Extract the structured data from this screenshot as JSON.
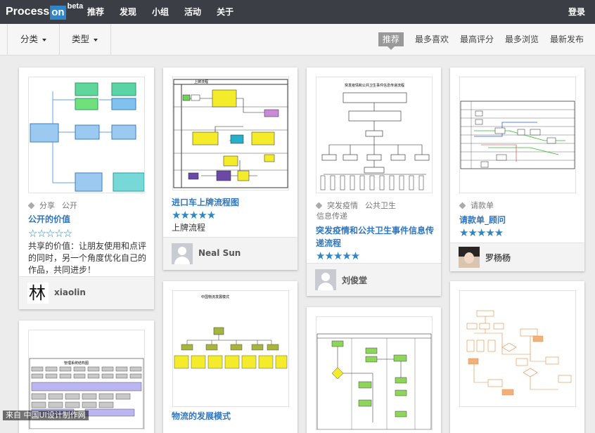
{
  "header": {
    "logo_text": "Process",
    "logo_on": "on",
    "logo_beta": "beta",
    "nav": [
      "推荐",
      "发现",
      "小组",
      "活动",
      "关于"
    ],
    "login": "登录"
  },
  "filters": {
    "category": "分类",
    "type": "类型",
    "sorts": [
      "推荐",
      "最多喜欢",
      "最高评分",
      "最多浏览",
      "最新发布"
    ],
    "active_sort": "推荐"
  },
  "cards": [
    {
      "tags": [
        "分享",
        "公开"
      ],
      "title": "公开的价值",
      "rating": 0,
      "desc": "共享的价值：让朋友使用和点评的同时，另一个角度优化自己的作品，共同进步！",
      "author": "xiaolin",
      "avatar_char": "林"
    },
    {
      "tags": [],
      "title": "进口车上牌流程图",
      "rating": 5,
      "desc": "上牌流程",
      "author": "Neal Sun",
      "thumb_title": "上牌流程"
    },
    {
      "tags": [
        "突发疫情",
        "公共卫生",
        "信息传递"
      ],
      "title": "突发疫情和公共卫生事件信息传递流程",
      "rating": 5,
      "desc": "",
      "author": "刘俊堂",
      "thumb_title": "突发疫情和公共卫生事件信息传递流程"
    },
    {
      "tags": [
        "请款单"
      ],
      "title": "请款单_顾问",
      "rating": 5,
      "desc": "",
      "author": "罗杨杨"
    },
    {
      "title": "物流的发展模式",
      "thumb_title": "中国物流发展模式"
    },
    {
      "title": ""
    },
    {
      "title": ""
    },
    {
      "title": ""
    }
  ],
  "watermark": "来自 中国UI设计制作网",
  "colors": {
    "topbar": "#3b3f45",
    "accent": "#2f85c6",
    "link": "#2f75c0"
  }
}
